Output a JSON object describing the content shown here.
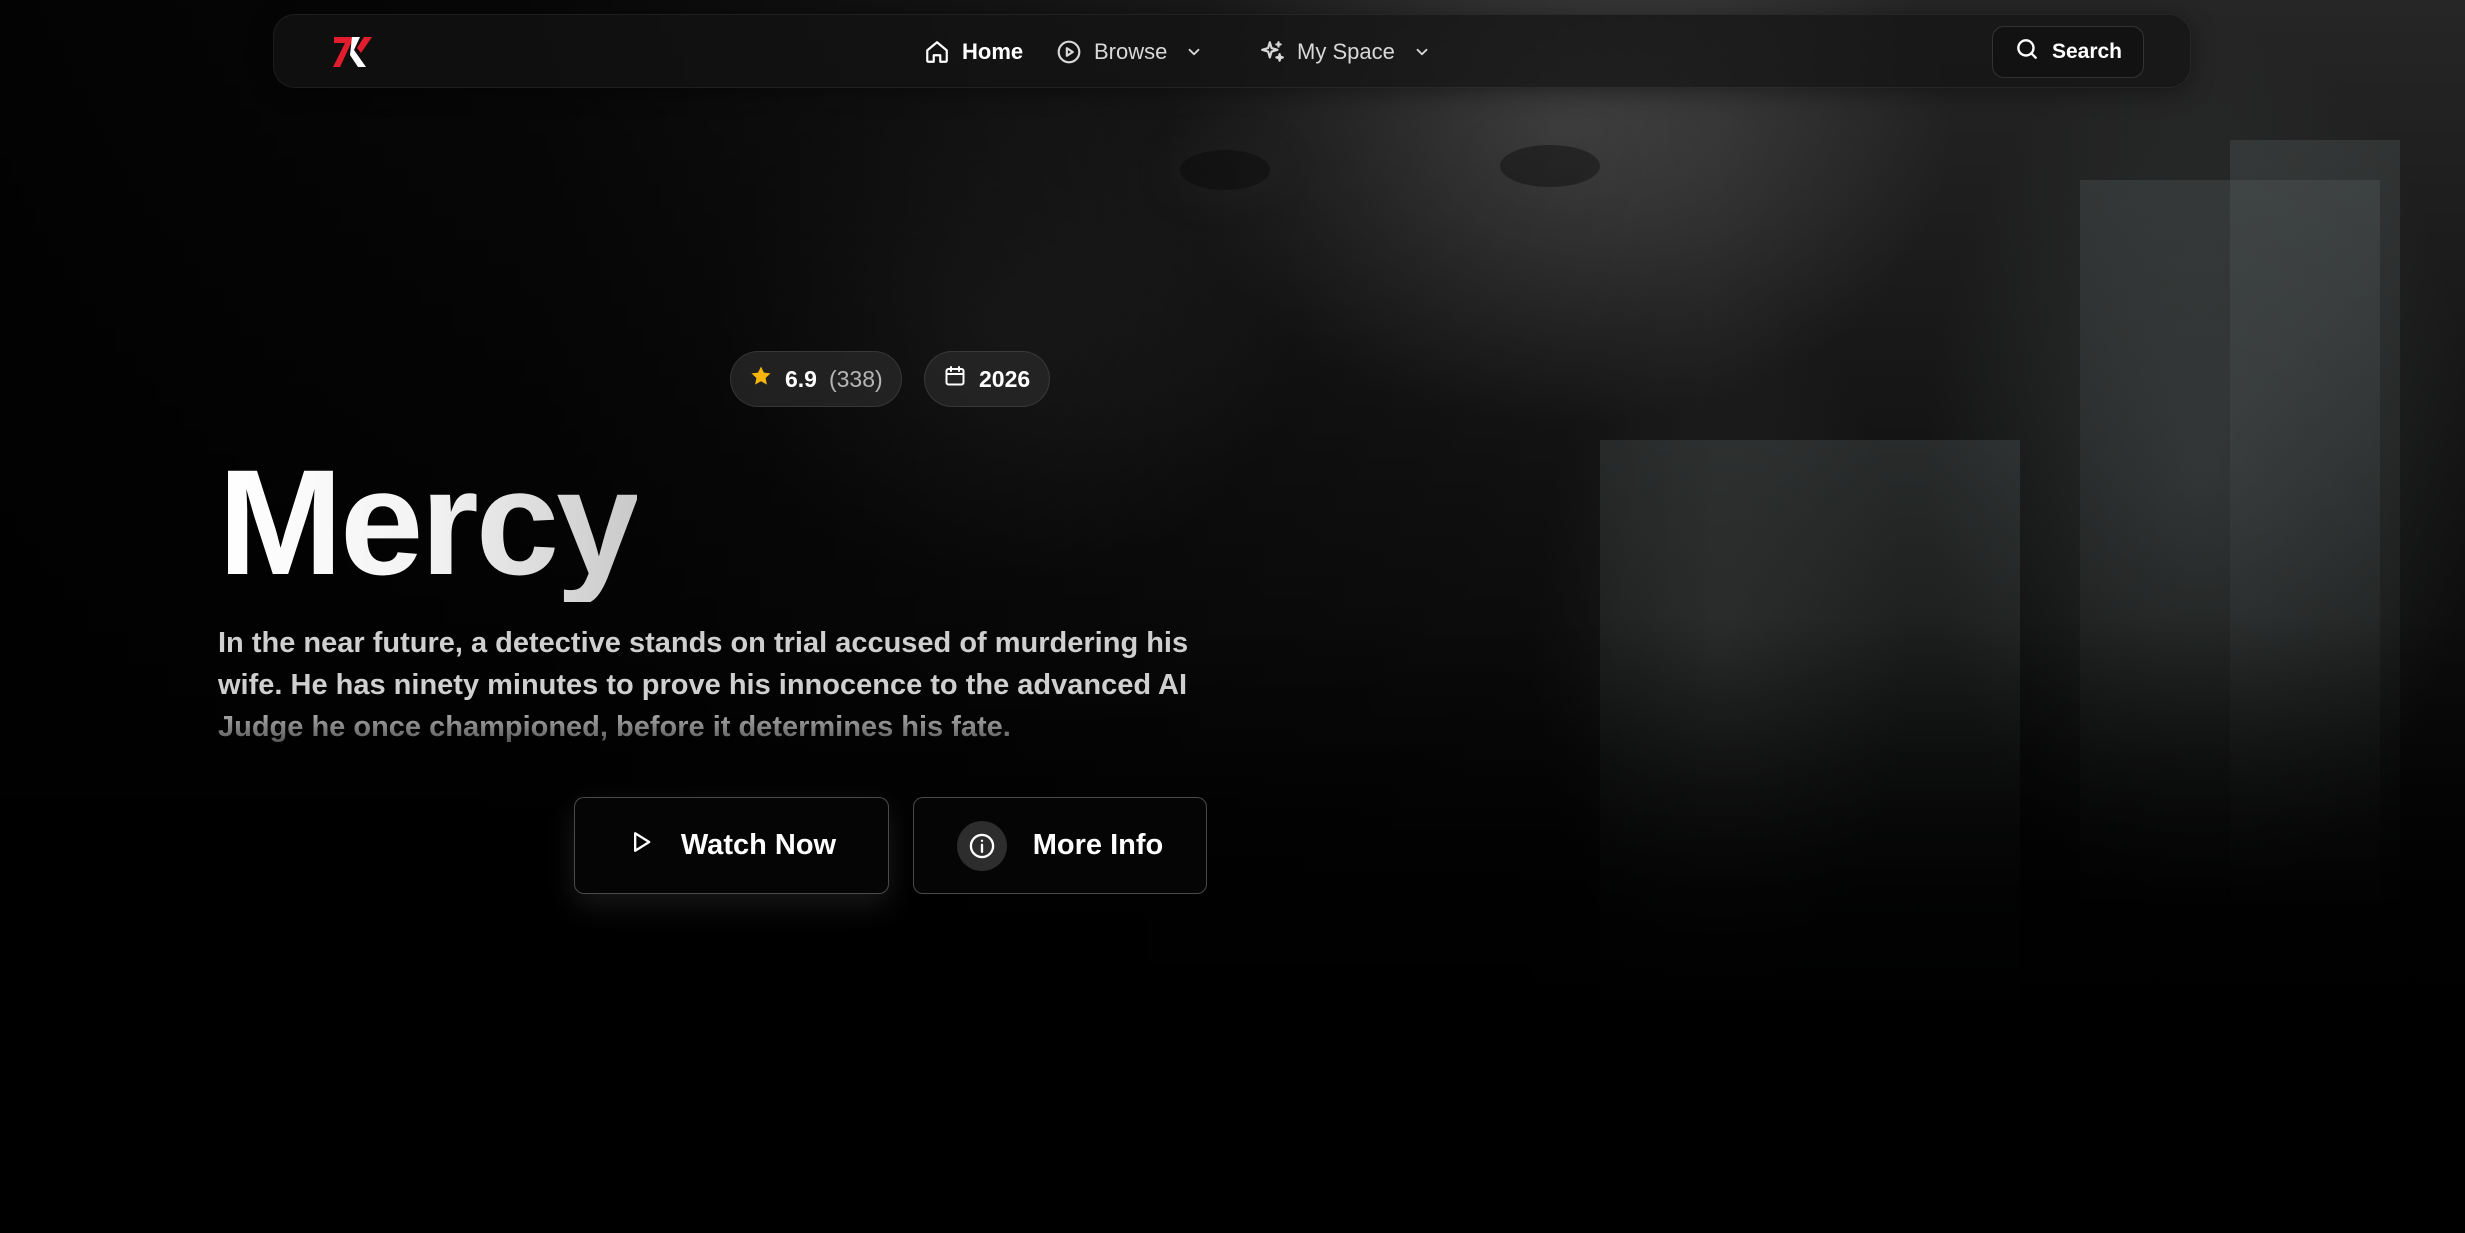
{
  "nav": {
    "logo_text": "ZK",
    "items": [
      {
        "label": "Home",
        "icon": "home-icon"
      },
      {
        "label": "Browse",
        "icon": "play-circle-icon"
      },
      {
        "label": "My Space",
        "icon": "sparkles-icon"
      }
    ],
    "search_label": "Search"
  },
  "hero": {
    "rating": "6.9",
    "rating_count": "(338)",
    "year": "2026",
    "title": "Mercy",
    "overview": "In the near future, a detective stands on trial accused of murdering his wife. He has ninety minutes to prove his innocence to the advanced AI Judge he once championed, before it determines his fate.",
    "watch_label": "Watch Now",
    "info_label": "More Info"
  },
  "colors": {
    "background": "#000000",
    "star": "#f5b50a",
    "logo_red": "#e11d2e"
  }
}
